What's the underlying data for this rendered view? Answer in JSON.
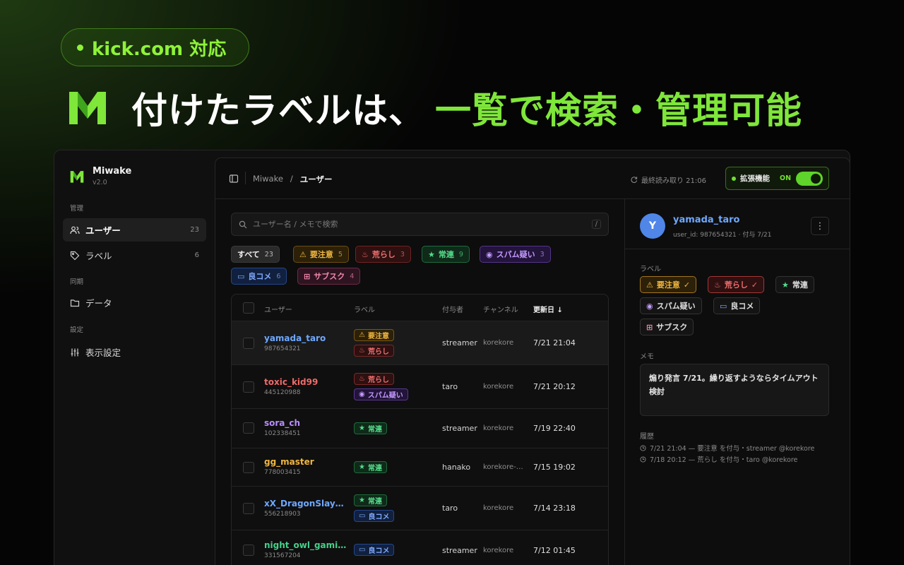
{
  "hero": {
    "badge": "kick.com 対応",
    "headline_white": "付けたラベルは、",
    "headline_green": "一覧で検索・管理可能",
    "logo_icon": "miwake-logo-icon"
  },
  "colors": {
    "accent_green": "#7fe63a",
    "caution": "#e3a32a",
    "rough": "#e05a5a",
    "regular": "#3fc877",
    "spam": "#a66bff",
    "good": "#5a8fff",
    "sub": "#e06a8a"
  },
  "sidebar": {
    "app_name": "Miwake",
    "version": "v2.0",
    "section_manage": "管理",
    "section_sync": "同期",
    "section_settings": "設定",
    "items": [
      {
        "label": "ユーザー",
        "count": "23",
        "icon": "users-icon"
      },
      {
        "label": "ラベル",
        "count": "6",
        "icon": "tag-icon"
      },
      {
        "label": "データ",
        "icon": "folder-icon"
      },
      {
        "label": "表示設定",
        "icon": "sliders-icon"
      }
    ]
  },
  "topbar": {
    "crumb_root": "Miwake",
    "crumb_sep": "/",
    "crumb_current": "ユーザー",
    "last_read": "最終読み取り 21:06",
    "ext_label": "拡張機能",
    "ext_state": "ON"
  },
  "search": {
    "placeholder": "ユーザー名 / メモで検索",
    "shortcut": "/"
  },
  "filters": [
    {
      "label": "すべて",
      "count": "23"
    },
    {
      "label": "要注意",
      "count": "5"
    },
    {
      "label": "荒らし",
      "count": "3"
    },
    {
      "label": "常連",
      "count": "9"
    },
    {
      "label": "スパム疑い",
      "count": "3"
    },
    {
      "label": "良コメ",
      "count": "6"
    },
    {
      "label": "サブスク",
      "count": "4"
    }
  ],
  "table": {
    "headers": {
      "user": "ユーザー",
      "label": "ラベル",
      "giver": "付与者",
      "channel": "チャンネル",
      "updated": "更新日 ↓"
    },
    "rows": [
      {
        "name": "yamada_taro",
        "id": "987654321",
        "labels": [
          "要注意",
          "荒らし"
        ],
        "giver": "streamer",
        "channel": "korekore",
        "date": "7/21 21:04"
      },
      {
        "name": "toxic_kid99",
        "id": "445120988",
        "labels": [
          "荒らし",
          "スパム疑い"
        ],
        "giver": "taro",
        "channel": "korekore",
        "date": "7/21 20:12"
      },
      {
        "name": "sora_ch",
        "id": "102338451",
        "labels": [
          "常連"
        ],
        "giver": "streamer",
        "channel": "korekore",
        "date": "7/19 22:40"
      },
      {
        "name": "gg_master",
        "id": "778003415",
        "labels": [
          "常連"
        ],
        "giver": "hanako",
        "channel": "korekore-…",
        "date": "7/15 19:02"
      },
      {
        "name": "xX_DragonSlaye…",
        "id": "556218903",
        "labels": [
          "常連",
          "良コメ"
        ],
        "giver": "taro",
        "channel": "korekore",
        "date": "7/14 23:18"
      },
      {
        "name": "night_owl_gaming",
        "id": "331567204",
        "labels": [
          "良コメ"
        ],
        "giver": "streamer",
        "channel": "korekore",
        "date": "7/12 01:45"
      }
    ]
  },
  "detail": {
    "avatar": "Y",
    "name": "yamada_taro",
    "meta": "user_id: 987654321 · 付与 7/21",
    "labels_title": "ラベル",
    "labels": [
      "要注意",
      "荒らし",
      "常連",
      "スパム疑い",
      "良コメ",
      "サブスク"
    ],
    "check": "✓",
    "memo_title": "メモ",
    "memo": "煽り発言 7/21。繰り返すようならタイムアウト検討",
    "history_title": "履歴",
    "history": [
      "7/21 21:04 — 要注意 を付与・streamer @korekore",
      "7/18 20:12 — 荒らし を付与・taro @korekore"
    ]
  }
}
